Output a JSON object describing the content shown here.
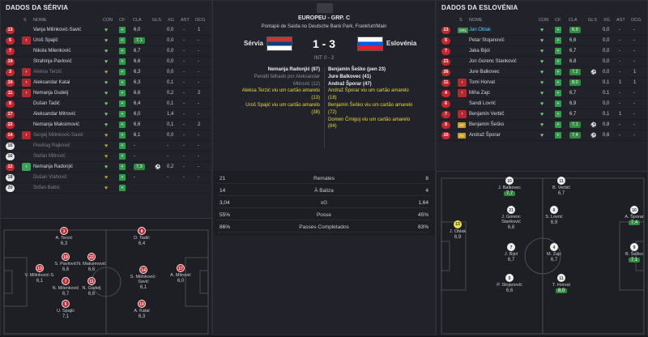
{
  "left": {
    "title": "DADOS DA SÉRVIA",
    "headers": {
      "s": "S",
      "nome": "NOME",
      "con": "CON",
      "cf": "CF",
      "cla": "CLA",
      "gls": "GLS",
      "xg": "XG",
      "ast": "AST",
      "ocg": "OCG"
    },
    "rows": [
      {
        "num": "13",
        "nome": "Vanja Milinković-Savić",
        "cla": "6,0",
        "gls": "",
        "xg": "0,0",
        "ast": "-",
        "ocg": "1",
        "dim": false,
        "arrow": ""
      },
      {
        "num": "5",
        "nome": "Uroš Spajić",
        "cla": "7,1",
        "gls": "",
        "xg": "0,0",
        "ast": "-",
        "ocg": "-",
        "dim": false,
        "arrow": "out",
        "green": true
      },
      {
        "num": "7",
        "nome": "Nikola Milenković",
        "cla": "6,7",
        "gls": "",
        "xg": "0,0",
        "ast": "-",
        "ocg": "-",
        "dim": false,
        "arrow": ""
      },
      {
        "num": "19",
        "nome": "Strahinja Pavlović",
        "cla": "6,6",
        "gls": "",
        "xg": "0,0",
        "ast": "-",
        "ocg": "-",
        "dim": false,
        "arrow": ""
      },
      {
        "num": "3",
        "nome": "Aleksa Terzić",
        "cla": "6,3",
        "gls": "",
        "xg": "0,0",
        "ast": "-",
        "ocg": "-",
        "dim": true,
        "arrow": "out"
      },
      {
        "num": "10",
        "nome": "Aleksandar Katai",
        "cla": "6,3",
        "gls": "",
        "xg": "0,1",
        "ast": "-",
        "ocg": "-",
        "dim": false,
        "arrow": "out"
      },
      {
        "num": "11",
        "nome": "Nemanja Gudelj",
        "cla": "6,6",
        "gls": "",
        "xg": "0,2",
        "ast": "-",
        "ocg": "2",
        "dim": false,
        "arrow": "out"
      },
      {
        "num": "8",
        "nome": "Dušan Tadić",
        "cla": "6,4",
        "gls": "",
        "xg": "0,1",
        "ast": "-",
        "ocg": "-",
        "dim": false,
        "arrow": ""
      },
      {
        "num": "17",
        "nome": "Aleksandar Mitrović",
        "cla": "6,0",
        "gls": "",
        "xg": "1,4",
        "ast": "-",
        "ocg": "-",
        "dim": false,
        "arrow": ""
      },
      {
        "num": "22",
        "nome": "Nemanja Maksimović",
        "cla": "6,6",
        "gls": "",
        "xg": "0,1",
        "ast": "-",
        "ocg": "2",
        "dim": false,
        "arrow": ""
      },
      {
        "num": "14",
        "nome": "Sergej Milinković-Savić",
        "cla": "6,1",
        "gls": "",
        "xg": "0,0",
        "ast": "-",
        "ocg": "-",
        "dim": true,
        "arrow": "out"
      },
      {
        "num": "15",
        "nome": "Predrag Rajković",
        "cla": "-",
        "gls": "",
        "xg": "-",
        "ast": "-",
        "ocg": "-",
        "dim": true,
        "arrow": "",
        "white": true
      },
      {
        "num": "16",
        "nome": "Stefan Mitrović",
        "cla": "-",
        "gls": "",
        "xg": "-",
        "ast": "-",
        "ocg": "-",
        "dim": true,
        "arrow": "",
        "white": true
      },
      {
        "num": "12",
        "nome": "Nemanja Radonjić",
        "cla": "7,3",
        "gls": "",
        "xg": "0,2",
        "ast": "-",
        "ocg": "-",
        "dim": false,
        "arrow": "in",
        "green": true,
        "ball": true
      },
      {
        "num": "18",
        "nome": "Dušan Vlahović",
        "cla": "-",
        "gls": "",
        "xg": "-",
        "ast": "-",
        "ocg": "-",
        "dim": true,
        "arrow": "",
        "white": true
      },
      {
        "num": "20",
        "nome": "Srđan Babić",
        "cla": "",
        "gls": "",
        "xg": "",
        "ast": "",
        "ocg": "",
        "dim": true,
        "arrow": "",
        "white": true
      }
    ],
    "pitch": [
      {
        "num": "3",
        "name": "A. Terzić",
        "rt": "6,3"
      },
      {
        "num": "8",
        "name": "D. Tadić",
        "rt": "6,4"
      },
      {
        "num": "19",
        "name": "S. Pavlović",
        "rt": "6,6"
      },
      {
        "num": "22",
        "name": "N. Maksimović",
        "rt": "6,6"
      },
      {
        "num": "13",
        "name": "V. Milinković-S.",
        "rt": "6,1"
      },
      {
        "num": "7",
        "name": "N. Milenković",
        "rt": "6,7"
      },
      {
        "num": "11",
        "name": "N. Gudelj",
        "rt": "6,6"
      },
      {
        "num": "14",
        "name": "S. Milinković-Savić",
        "rt": "6,1"
      },
      {
        "num": "17",
        "name": "A. Mitrović",
        "rt": "6,0"
      },
      {
        "num": "5",
        "name": "U. Spajić",
        "rt": "7,1"
      },
      {
        "num": "10",
        "name": "A. Katai",
        "rt": "6,3"
      }
    ]
  },
  "center": {
    "competition": "EUROPEU - GRP. C",
    "stadium": "Pontapé de Saída no Deutsche Bank Park, Frankfurt/Main",
    "home": "Sérvia",
    "away": "Eslovénia",
    "score": "1 - 3",
    "ht": "INT: 0 - 2",
    "home_events": [
      {
        "text": "Nemanja Radonjić (87)",
        "style": "bold"
      },
      {
        "text": "Penálti falhado por Aleksandar",
        "style": "dim"
      },
      {
        "text": "Mitrović (12)",
        "style": "dim"
      },
      {
        "text": "Aleksa Terzić viu um cartão amarelo",
        "style": "yellow"
      },
      {
        "text": "(13)",
        "style": "yellow"
      },
      {
        "text": "Uroš Spajić viu um cartão amarelo",
        "style": "yellow"
      },
      {
        "text": "(38)",
        "style": "yellow"
      }
    ],
    "away_events": [
      {
        "text": "Benjamin Šeško (pen 23)",
        "style": "bold"
      },
      {
        "text": "Jure Balkovec (41)",
        "style": "bold"
      },
      {
        "text": "Andraž Šporar (47)",
        "style": "bold"
      },
      {
        "text": "Andraž Šporar viu um cartão amarelo",
        "style": "yellow"
      },
      {
        "text": "(18)",
        "style": "yellow"
      },
      {
        "text": "Benjamin Šeško viu um cartão amarelo",
        "style": "yellow"
      },
      {
        "text": "(72)",
        "style": "yellow"
      },
      {
        "text": "Domen Črnigoj viu um cartão amarelo",
        "style": "yellow"
      },
      {
        "text": "(84)",
        "style": "yellow"
      }
    ],
    "stats": [
      {
        "h": "21",
        "label": "Remates",
        "a": "8"
      },
      {
        "h": "14",
        "label": "À Baliza",
        "a": "4"
      },
      {
        "h": "3,04",
        "label": "xG",
        "a": "1,64"
      },
      {
        "h": "55%",
        "label": "Posse",
        "a": "45%"
      },
      {
        "h": "86%",
        "label": "Passes Completados",
        "a": "83%"
      }
    ]
  },
  "right": {
    "title": "DADOS DA ESLOVÉNIA",
    "headers": {
      "s": "S",
      "nome": "NOME",
      "con": "CON",
      "cf": "CF",
      "cla": "CLA",
      "gls": "GLS",
      "xg": "XG",
      "ast": "AST",
      "ocg": "OCG"
    },
    "rows": [
      {
        "num": "13",
        "nome": "Jan Oblak",
        "cla": "6,9",
        "gls": "",
        "xg": "0,0",
        "ast": "-",
        "ocg": "-",
        "tag": "GRL",
        "blue": true,
        "green": true
      },
      {
        "num": "5",
        "nome": "Petar Stojanović",
        "cla": "6,6",
        "gls": "",
        "xg": "0,0",
        "ast": "-",
        "ocg": "-"
      },
      {
        "num": "7",
        "nome": "Jaka Bijol",
        "cla": "6,7",
        "gls": "",
        "xg": "0,0",
        "ast": "-",
        "ocg": "-"
      },
      {
        "num": "21",
        "nome": "Jon Gorenc Stanković",
        "cla": "6,8",
        "gls": "",
        "xg": "0,0",
        "ast": "-",
        "ocg": "-"
      },
      {
        "num": "26",
        "nome": "Jure Balkovec",
        "cla": "7,2",
        "gls": "1",
        "xg": "0,0",
        "ast": "-",
        "ocg": "1",
        "green": true,
        "ball": true
      },
      {
        "num": "11",
        "nome": "Tomi Horvat",
        "cla": "8,0",
        "gls": "",
        "xg": "0,1",
        "ast": "1",
        "ocg": "1",
        "arrow": "out",
        "green": true
      },
      {
        "num": "4",
        "nome": "Miha Zajc",
        "cla": "6,7",
        "gls": "",
        "xg": "0,1",
        "ast": "-",
        "ocg": "-",
        "arrow": "out"
      },
      {
        "num": "6",
        "nome": "Sandi Lovrić",
        "cla": "6,9",
        "gls": "",
        "xg": "0,0",
        "ast": "-",
        "ocg": "-"
      },
      {
        "num": "7",
        "nome": "Benjamin Verbič",
        "cla": "6,7",
        "gls": "",
        "xg": "0,1",
        "ast": "1",
        "ocg": "-",
        "arrow": "out"
      },
      {
        "num": "9",
        "nome": "Benjamin Šeško",
        "cla": "7,1",
        "gls": "1",
        "xg": "0,8",
        "ast": "-",
        "ocg": "-",
        "tag": "AV",
        "green": true,
        "ball": true
      },
      {
        "num": "10",
        "nome": "Andraž Šporar",
        "cla": "7,4",
        "gls": "1",
        "xg": "0,6",
        "ast": "-",
        "ocg": "-",
        "tag": "AV",
        "green": true,
        "ball": true
      }
    ],
    "pitch": [
      {
        "num": "10",
        "name": "J. Balkovec",
        "rt": "7,7",
        "green": true
      },
      {
        "num": "11",
        "name": "B. Verbič",
        "rt": "6,7"
      },
      {
        "num": "21",
        "name": "J. Gorenc Stanković",
        "rt": "6,8"
      },
      {
        "num": "6",
        "name": "S. Lovrić",
        "rt": "6,9"
      },
      {
        "num": "10",
        "name": "A. Šporar",
        "rt": "7,4",
        "green": true
      },
      {
        "num": "13",
        "name": "J. Oblak",
        "rt": "6,9",
        "gk": true
      },
      {
        "num": "7",
        "name": "J. Bijol",
        "rt": "6,7"
      },
      {
        "num": "4",
        "name": "M. Zajc",
        "rt": "6,7"
      },
      {
        "num": "9",
        "name": "B. Šeško",
        "rt": "7,1",
        "green": true
      },
      {
        "num": "5",
        "name": "P. Stojanović",
        "rt": "6,6"
      },
      {
        "num": "11",
        "name": "T. Horvat",
        "rt": "8,0",
        "green": true
      }
    ]
  },
  "colors": {
    "red": "#c8262f",
    "green": "#2f8a3f",
    "yellow": "#e8e23a",
    "bg": "#15161c",
    "panel": "#22232a"
  }
}
